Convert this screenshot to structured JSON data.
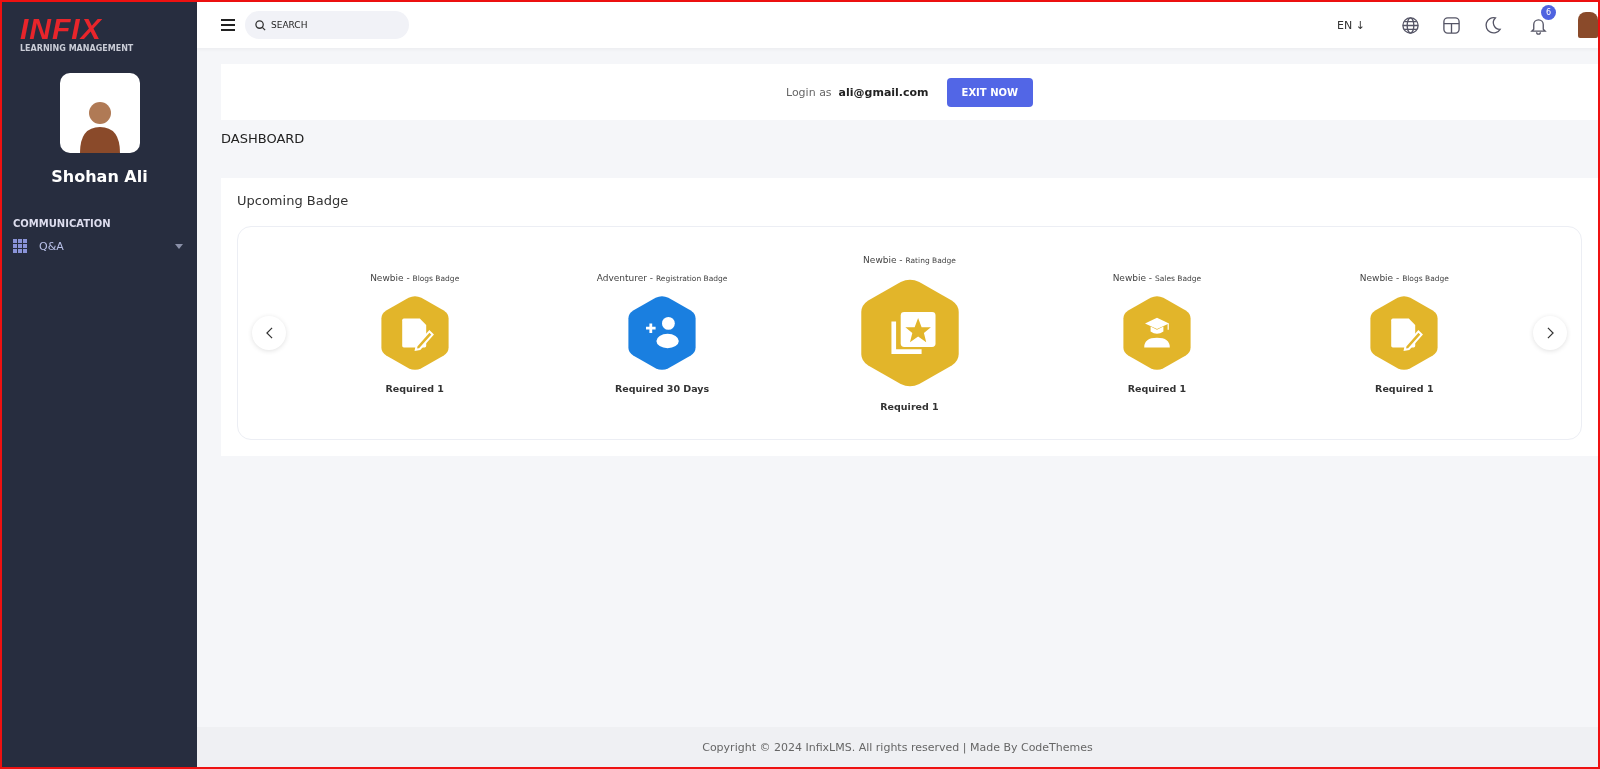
{
  "sidebar": {
    "logo": {
      "title": "INFIX",
      "subtitle": "LEARNING MANAGEMENT"
    },
    "user_name": "Shohan Ali",
    "section": "COMMUNICATION",
    "items": [
      {
        "label": "Q&A",
        "expanded": false
      }
    ]
  },
  "topbar": {
    "search": {
      "placeholder": "SEARCH"
    },
    "language": "EN ↓",
    "notifications": "6"
  },
  "impersonation": {
    "prefix": "Login as",
    "email": "ali@gmail.com",
    "button": "EXIT NOW"
  },
  "page_title": "DASHBOARD",
  "upcoming": {
    "title": "Upcoming Badge",
    "badges": [
      {
        "name": "Newbie -",
        "type": "Blogs Badge",
        "requirement": "Required 1",
        "color": "#e2b52a",
        "kind": "note",
        "selected": false
      },
      {
        "name": "Adventurer -",
        "type": "Registration Badge",
        "requirement": "Required 30 Days",
        "color": "#1a7fe0",
        "kind": "registration",
        "selected": false
      },
      {
        "name": "Newbie -",
        "type": "Rating Badge",
        "requirement": "Required 1",
        "color": "#e2b52a",
        "kind": "rating",
        "selected": true
      },
      {
        "name": "Newbie -",
        "type": "Sales Badge",
        "requirement": "Required 1",
        "color": "#e2b52a",
        "kind": "sales",
        "selected": false
      },
      {
        "name": "Newbie -",
        "type": "Blogs Badge",
        "requirement": "Required 1",
        "color": "#e2b52a",
        "kind": "note",
        "selected": false
      }
    ]
  },
  "footer": "Copyright © 2024 InfixLMS. All rights reserved | Made By CodeThemes"
}
